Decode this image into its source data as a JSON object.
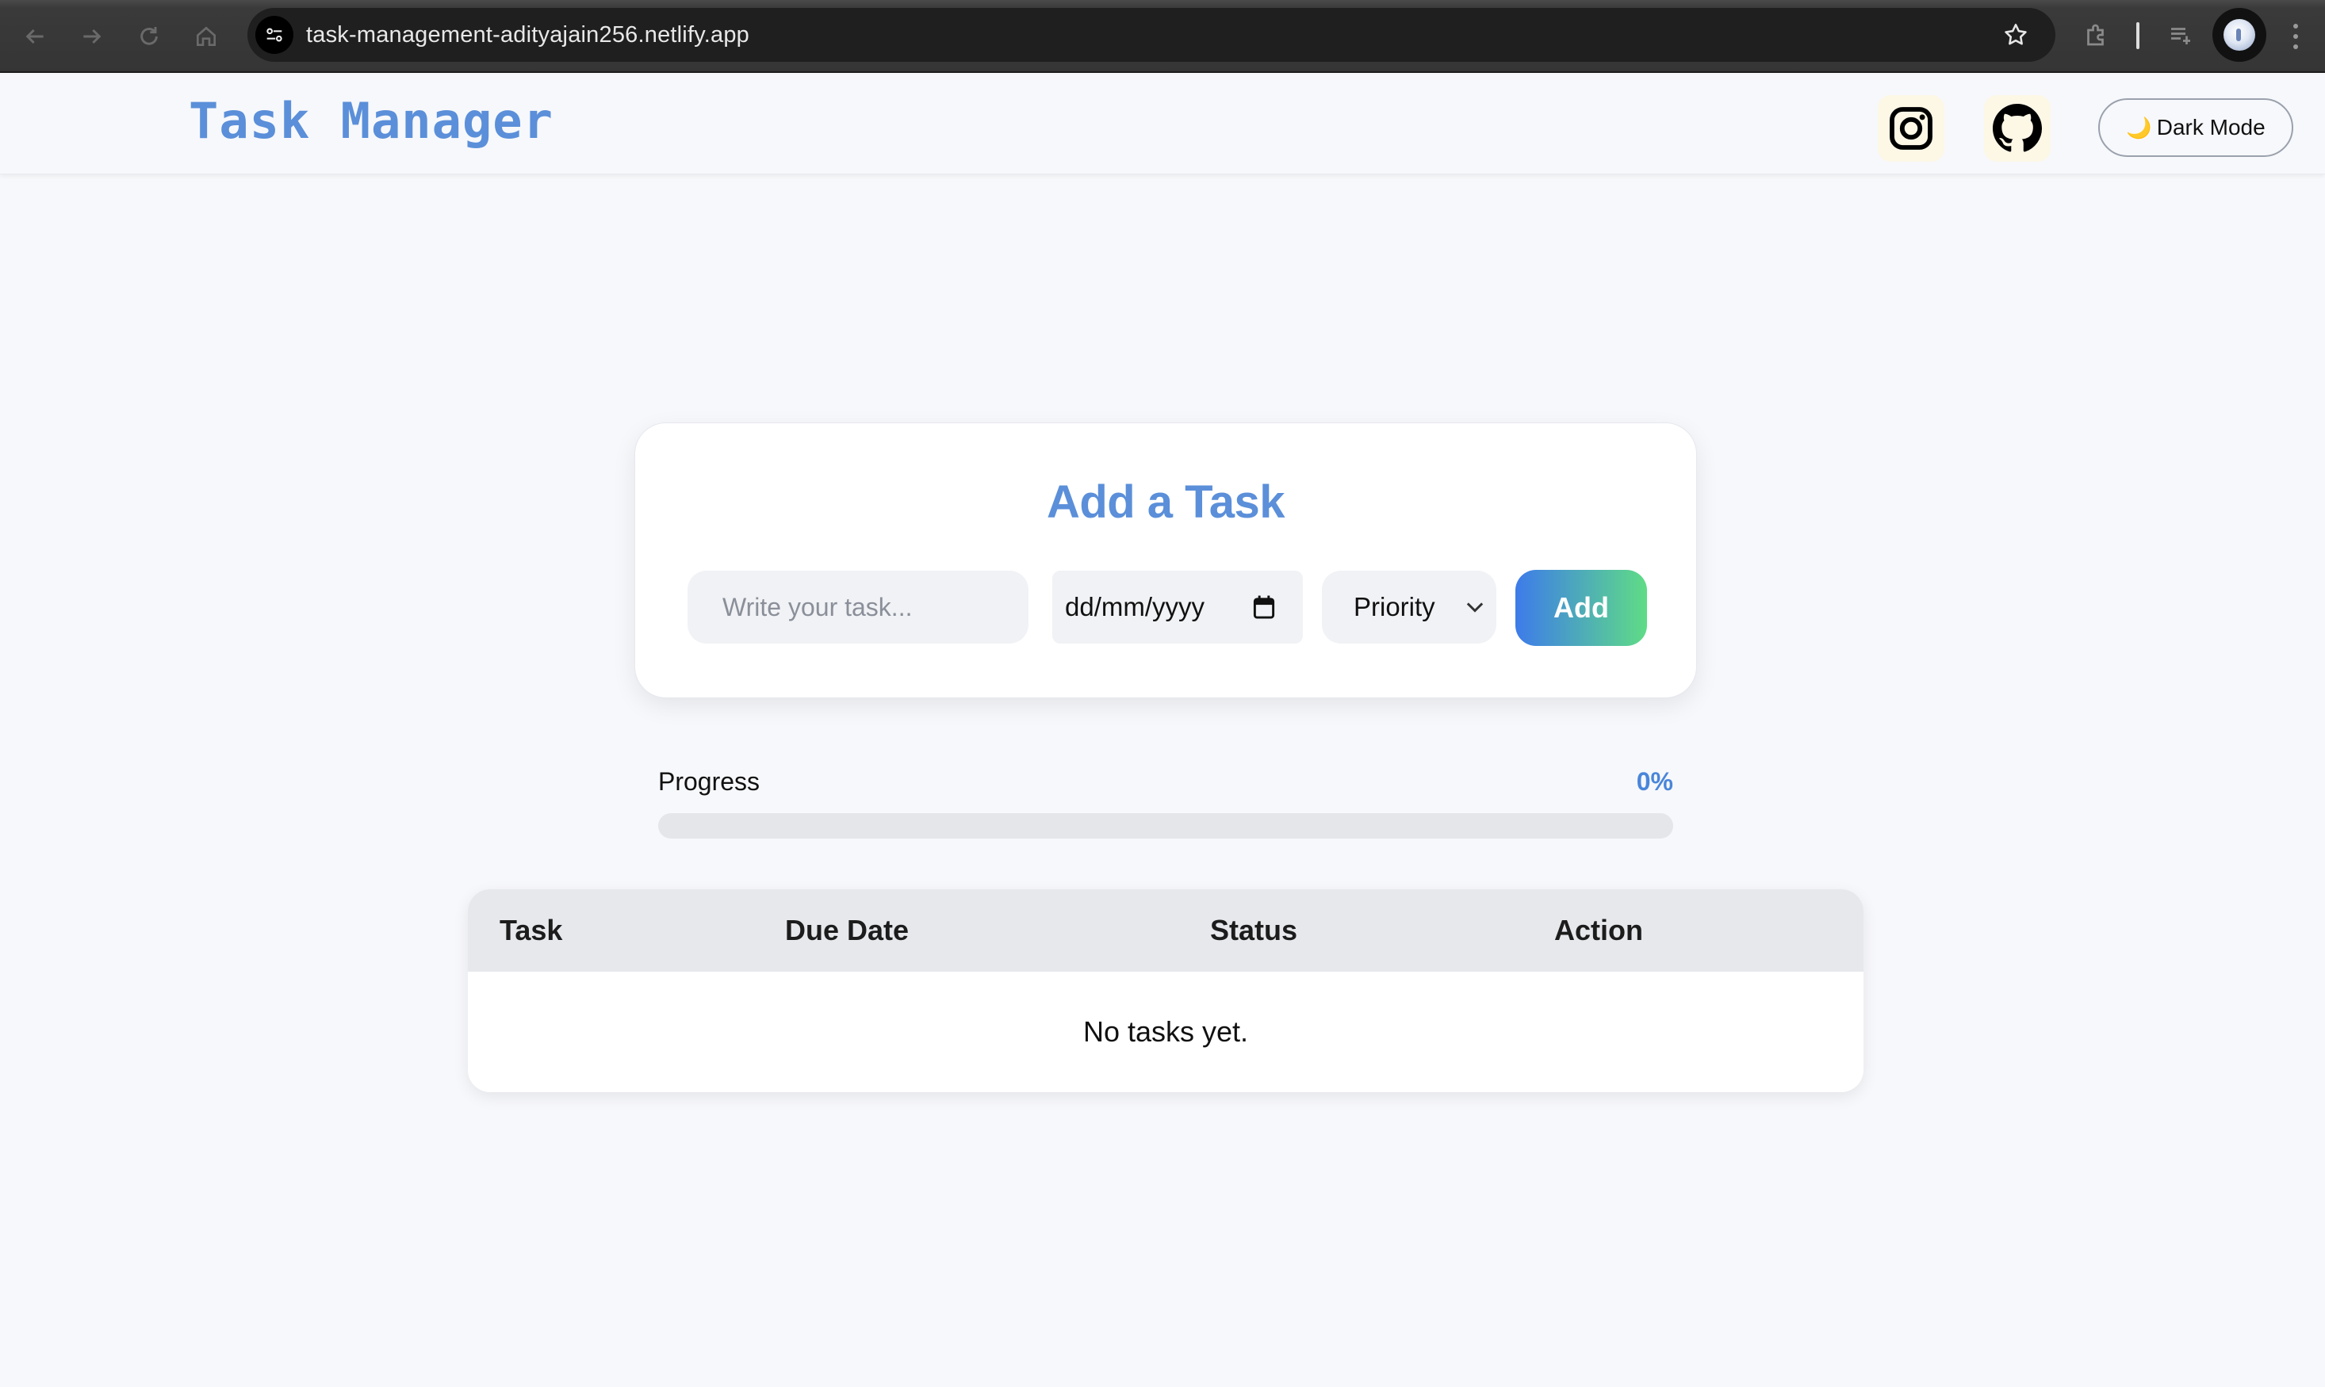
{
  "browser": {
    "url": "task-management-adityajain256.netlify.app"
  },
  "header": {
    "title": "Task Manager",
    "dark_mode_label": "Dark Mode",
    "dark_mode_icon": "🌙"
  },
  "add_task": {
    "heading": "Add a Task",
    "task_placeholder": "Write your task...",
    "date_placeholder": "dd/mm/yyyy",
    "priority_selected": "Priority",
    "add_label": "Add"
  },
  "progress": {
    "label": "Progress",
    "value_text": "0%",
    "value": 0
  },
  "table": {
    "columns": [
      "Task",
      "Due Date",
      "Status",
      "Action"
    ],
    "empty_message": "No tasks yet."
  },
  "colors": {
    "accent": "#5b8fd9",
    "progress": "#4a86da",
    "add_gradient_start": "#3d7bea",
    "add_gradient_end": "#5fdc86"
  }
}
